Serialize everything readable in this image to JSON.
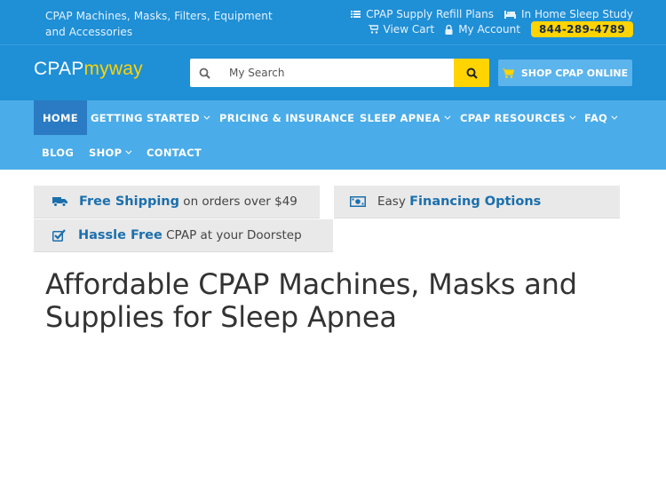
{
  "topbar": {
    "tagline": "CPAP Machines, Masks, Filters, Equipment and Accessories",
    "refill_plans": "CPAP Supply Refill Plans",
    "sleep_study": "In Home Sleep Study",
    "view_cart": "View Cart",
    "my_account": "My Account",
    "phone": "844-289-4789"
  },
  "header": {
    "logo_part1": "CPAP",
    "logo_part2": "myway",
    "search_placeholder": "My Search",
    "shop_button": "SHOP CPAP ONLINE"
  },
  "nav": {
    "items": [
      {
        "label": "HOME",
        "active": true
      },
      {
        "label": "GETTING STARTED",
        "dropdown": true
      },
      {
        "label": "PRICING & INSURANCE"
      },
      {
        "label": "SLEEP APNEA",
        "dropdown": true
      },
      {
        "label": "CPAP RESOURCES",
        "dropdown": true
      },
      {
        "label": "FAQ",
        "dropdown": true
      },
      {
        "label": "BLOG"
      },
      {
        "label": "SHOP",
        "dropdown": true
      },
      {
        "label": "CONTACT"
      }
    ]
  },
  "features": {
    "shipping_bold": "Free Shipping",
    "shipping_rest": " on orders over $49",
    "financing_pre": "Easy ",
    "financing_bold": "Financing Options",
    "hassle_bold": "Hassle Free",
    "hassle_rest": " CPAP at your Doorstep"
  },
  "main": {
    "heading": "Affordable CPAP Machines, Masks and Supplies for Sleep Apnea"
  },
  "colors": {
    "primary_blue": "#1f8fd6",
    "nav_blue": "#4aace8",
    "active_blue": "#2a7bc3",
    "accent_yellow": "#ffd400",
    "link_blue": "#1b6fad"
  }
}
